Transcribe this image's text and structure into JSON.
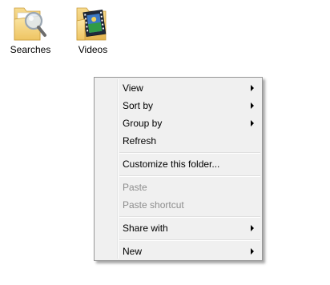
{
  "desktop": {
    "folders": [
      {
        "label": "Searches",
        "icon": "searches-folder-icon"
      },
      {
        "label": "Videos",
        "icon": "videos-folder-icon"
      }
    ]
  },
  "context_menu": {
    "items": [
      {
        "label": "View",
        "submenu": true,
        "enabled": true
      },
      {
        "label": "Sort by",
        "submenu": true,
        "enabled": true
      },
      {
        "label": "Group by",
        "submenu": true,
        "enabled": true
      },
      {
        "label": "Refresh",
        "submenu": false,
        "enabled": true
      },
      {
        "label": "Customize this folder...",
        "submenu": false,
        "enabled": true
      },
      {
        "label": "Paste",
        "submenu": false,
        "enabled": false
      },
      {
        "label": "Paste shortcut",
        "submenu": false,
        "enabled": false
      },
      {
        "label": "Share with",
        "submenu": true,
        "enabled": true
      },
      {
        "label": "New",
        "submenu": true,
        "enabled": true
      }
    ]
  },
  "colors": {
    "folder_yellow": "#f4d27a",
    "menu_background": "#f0f0f0",
    "menu_border": "#979797",
    "disabled_text": "#8d8d8d"
  }
}
